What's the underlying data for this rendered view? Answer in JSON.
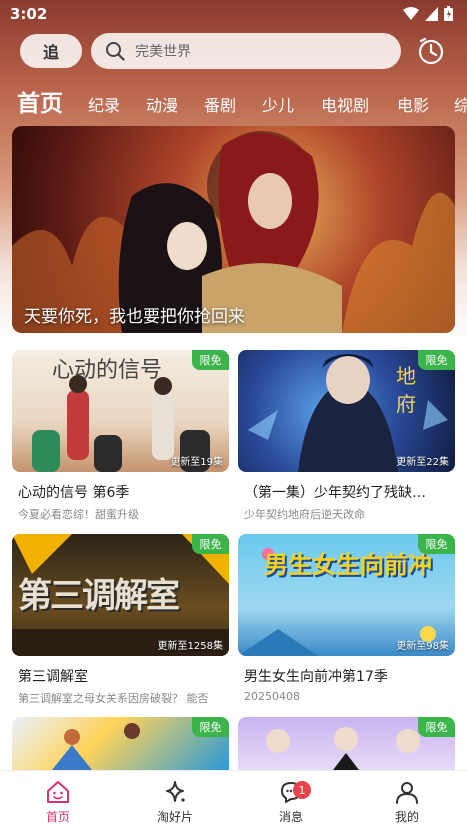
{
  "status_bar": {
    "time": "3:02"
  },
  "header": {
    "follow_label": "追",
    "search_placeholder": "完美世界"
  },
  "tabs": [
    {
      "label": "首页",
      "active": true
    },
    {
      "label": "纪录"
    },
    {
      "label": "动漫"
    },
    {
      "label": "番剧"
    },
    {
      "label": "少儿"
    },
    {
      "label": "电视剧"
    },
    {
      "label": "电影"
    },
    {
      "label": "综"
    }
  ],
  "banner": {
    "caption": "天要你死，我也要把你抢回来"
  },
  "cards": [
    {
      "title": "心动的信号 第6季",
      "subtitle": "今夏必看恋综！甜蜜升级",
      "badge": "限免",
      "update": "更新至19集",
      "art_text": "心动的信号"
    },
    {
      "title": "（第一集）少年契约了残缺…",
      "subtitle": "少年契约地府后逆天改命",
      "badge": "限免",
      "update": "更新至22集",
      "art_text": "地府"
    },
    {
      "title": "第三调解室",
      "subtitle": "第三调解室之母女关系因房破裂？ 能否",
      "badge": "限免",
      "update": "更新至1258集",
      "art_text": "第三调解室"
    },
    {
      "title": "男生女生向前冲第17季",
      "subtitle": "20250408",
      "badge": "限免",
      "update": "更新至98集",
      "art_text": "男生女生向前冲"
    },
    {
      "badge": "限免"
    },
    {
      "badge": "限免"
    }
  ],
  "bottom_nav": [
    {
      "label": "首页",
      "icon": "home-icon",
      "active": true
    },
    {
      "label": "淘好片",
      "icon": "sparkle-icon"
    },
    {
      "label": "消息",
      "icon": "message-icon",
      "badge": "1"
    },
    {
      "label": "我的",
      "icon": "profile-icon"
    }
  ],
  "colors": {
    "accent": "#d6336c",
    "badge_green": "#3bb54a",
    "notification_red": "#e8424a"
  }
}
